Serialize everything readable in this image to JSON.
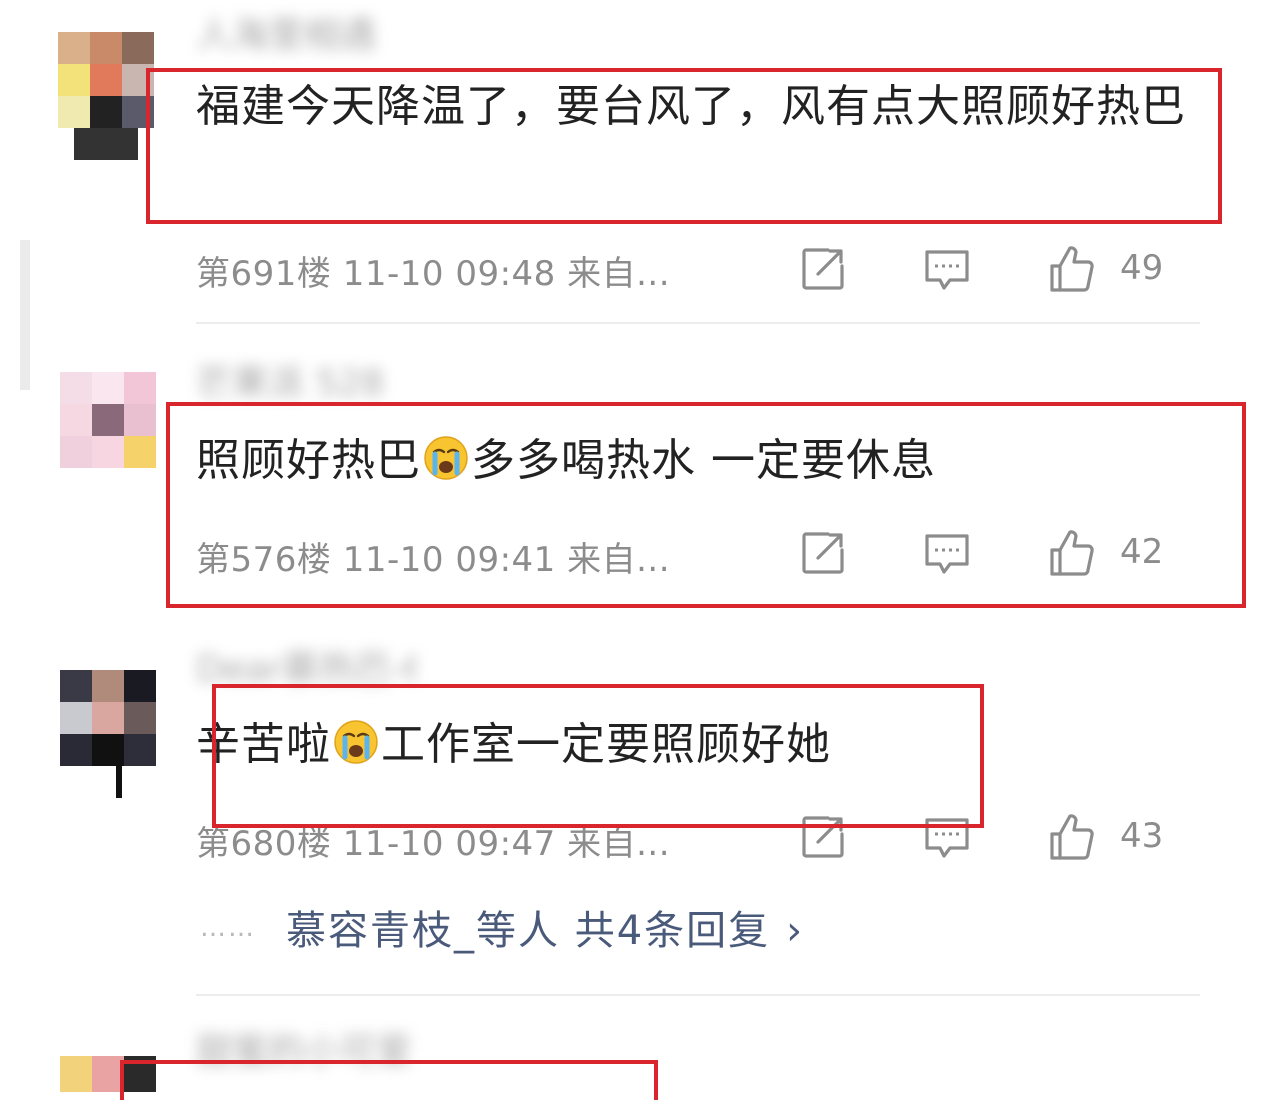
{
  "comments": [
    {
      "username": "人海里相遇",
      "text": "福建今天降温了，要台风了，风有点大照顾好热巴",
      "floor": "第691楼",
      "time": "11-10 09:48",
      "source": "来自...",
      "likes": "49"
    },
    {
      "username": "芒果派 528",
      "text_before": "照顾好热巴",
      "text_after": "多多喝热水 一定要休息",
      "floor": "第576楼",
      "time": "11-10 09:41",
      "source": "来自...",
      "likes": "42"
    },
    {
      "username": "Dear慕热巴-605",
      "text_before": "辛苦啦",
      "text_after": "工作室一定要照顾好她",
      "floor": "第680楼",
      "time": "11-10 09:47",
      "source": "来自...",
      "likes": "43",
      "replies_dots": "……",
      "replies_summary": "慕容青枝_等人  共4条回复",
      "replies_chevron": "›"
    },
    {
      "username": "甜蜜的小可爱"
    }
  ],
  "colors": {
    "highlight_box": "#d8262c",
    "meta_text": "#8c8c8c",
    "reply_link": "#4a5a7a"
  },
  "icons": [
    "share-icon",
    "comment-icon",
    "like-icon",
    "crying-emoji-icon"
  ]
}
